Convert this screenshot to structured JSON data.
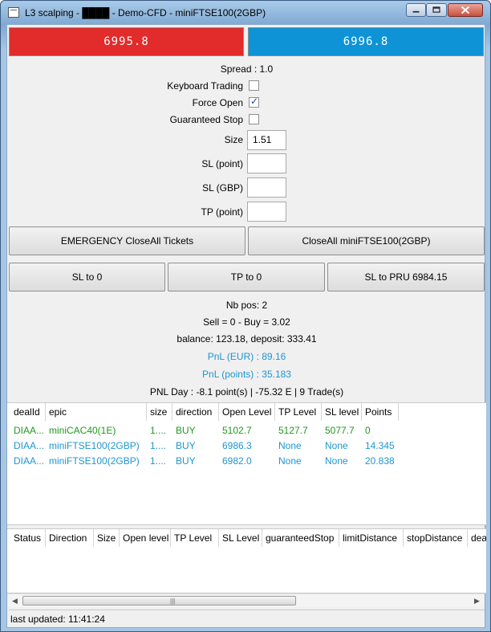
{
  "window": {
    "title": "L3 scalping - ████ - Demo-CFD - miniFTSE100(2GBP)"
  },
  "prices": {
    "sell": "6995.8",
    "buy": "6996.8",
    "sell_color": "#e22b2b",
    "buy_color": "#0e94d6"
  },
  "spread_text": "Spread : 1.0",
  "options": {
    "keyboard_trading": {
      "label": "Keyboard Trading",
      "checked": false
    },
    "force_open": {
      "label": "Force Open",
      "checked": true
    },
    "guaranteed_stop": {
      "label": "Guaranteed Stop",
      "checked": false
    }
  },
  "fields": {
    "size": {
      "label": "Size",
      "value": "1.51"
    },
    "sl_point": {
      "label": "SL (point)",
      "value": ""
    },
    "sl_gbp": {
      "label": "SL (GBP)",
      "value": ""
    },
    "tp_point": {
      "label": "TP (point)",
      "value": ""
    }
  },
  "buttons": {
    "emergency_close": "EMERGENCY CloseAll Tickets",
    "close_all": "CloseAll miniFTSE100(2GBP)",
    "sl_to_0": "SL to 0",
    "tp_to_0": "TP to 0",
    "sl_to_pru": "SL to PRU 6984.15"
  },
  "stats": {
    "nb_pos": "Nb pos: 2",
    "sell_buy": "Sell = 0 - Buy = 3.02",
    "balance": "balance: 123.18, deposit: 333.41",
    "pnl_eur": "PnL (EUR) : 89.16",
    "pnl_points": "PnL (points) : 35.183",
    "pnl_day": "PNL Day : -8.1 point(s) | -75.32 E | 9 Trade(s)"
  },
  "positions": {
    "columns": [
      "dealId",
      "epic",
      "size",
      "direction",
      "Open Level",
      "TP Level",
      "SL level",
      "Points"
    ],
    "rows": [
      [
        "DIAA...",
        "miniCAC40(1E)",
        "1....",
        "BUY",
        "5102.7",
        "5127.7",
        "5077.7",
        "0"
      ],
      [
        "DIAA...",
        "miniFTSE100(2GBP)",
        "1....",
        "BUY",
        "6986.3",
        "None",
        "None",
        "14.345"
      ],
      [
        "DIAA...",
        "miniFTSE100(2GBP)",
        "1....",
        "BUY",
        "6982.0",
        "None",
        "None",
        "20.838"
      ]
    ],
    "row_colors": [
      "#1f9a1f",
      "#1e96cf",
      "#1e96cf"
    ]
  },
  "orders": {
    "columns": [
      "Status",
      "Direction",
      "Size",
      "Open level",
      "TP Level",
      "SL Level",
      "guaranteedStop",
      "limitDistance",
      "stopDistance",
      "dea"
    ]
  },
  "status_bar": "last updated: 11:41:24"
}
